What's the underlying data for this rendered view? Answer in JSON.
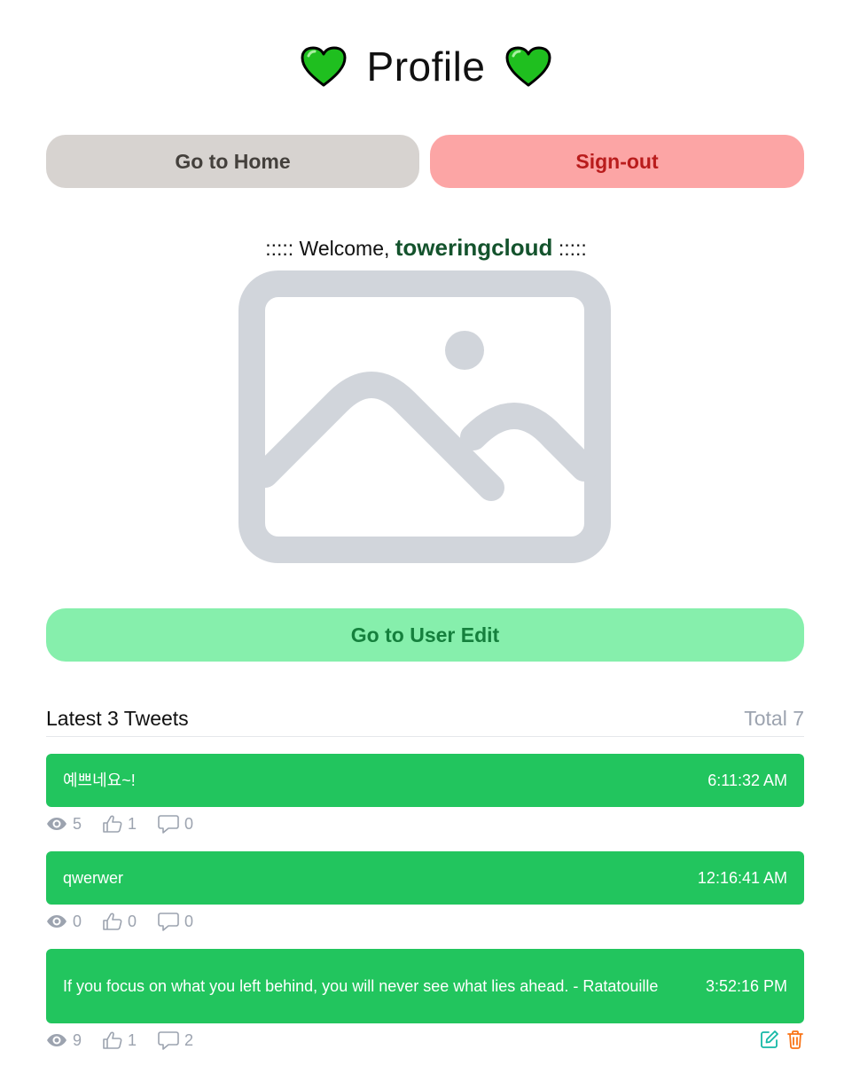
{
  "header": {
    "title": "Profile",
    "left_icon": "green-heart-icon",
    "right_icon": "green-heart-icon"
  },
  "nav": {
    "home_label": "Go to Home",
    "signout_label": "Sign-out"
  },
  "welcome": {
    "prefix": "::::: Welcome,",
    "username": "toweringcloud",
    "suffix": ":::::"
  },
  "avatar": {
    "icon": "image-placeholder-icon"
  },
  "edit": {
    "label": "Go to User Edit"
  },
  "tweets": {
    "title": "Latest 3 Tweets",
    "total": "Total 7",
    "items": [
      {
        "text": "예쁘네요~!",
        "time": "6:11:32 AM",
        "views": "5",
        "likes": "1",
        "comments": "0"
      },
      {
        "text": "qwerwer",
        "time": "12:16:41 AM",
        "views": "0",
        "likes": "0",
        "comments": "0"
      },
      {
        "text": "If you focus on what you left behind, you will never see what lies ahead. - Ratatouille",
        "time": "3:52:16 PM",
        "views": "9",
        "likes": "1",
        "comments": "2"
      }
    ]
  },
  "colors": {
    "accent_green": "#22c55e",
    "home_button": "#d7d3d0",
    "signout_button": "#fca5a5",
    "edit_button": "#86efac",
    "edit_icon": "#14b8a6",
    "delete_icon": "#f97316"
  }
}
